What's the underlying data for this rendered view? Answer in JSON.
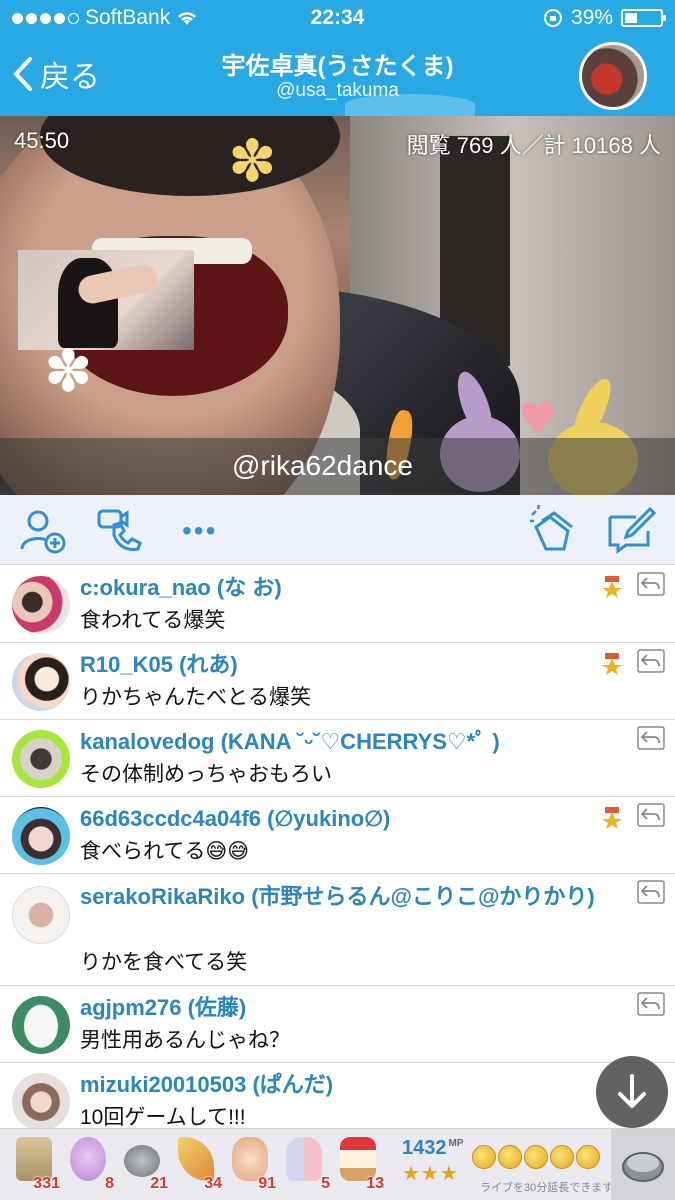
{
  "statusbar": {
    "carrier": "SoftBank",
    "time": "22:34",
    "battery": "39%"
  },
  "header": {
    "back_label": "戻る",
    "title": "宇佐卓真(うさたくま)",
    "handle": "@usa_takuma"
  },
  "video": {
    "elapsed": "45:50",
    "viewers": "閲覧 769 人／計 10168 人",
    "caption": "@rika62dance"
  },
  "toolbar": {
    "icons": [
      "add-user-icon",
      "call-icon",
      "more-icon",
      "clap-icon",
      "compose-icon"
    ],
    "more_label": "•••"
  },
  "comments": [
    {
      "name": "c:okura_nao (な お)",
      "text": "食われてる爆笑",
      "badge": true
    },
    {
      "name": "R10_K05 (れあ)",
      "text": "りかちゃんたべとる爆笑",
      "badge": true
    },
    {
      "name": "kanalovedog (KANA ˘ᵕ˘♡CHERRYS♡*ﾟ )",
      "text": "その体制めっちゃおもろい",
      "badge": false
    },
    {
      "name": "66d63ccdc4a04f6 (∅yukino∅)",
      "text": "食べられてる😅😅",
      "badge": true
    },
    {
      "name": "serakoRikaRiko (市野せらるん@こりこ@かりかり)",
      "text": "りかを食べてる笑",
      "badge": false
    },
    {
      "name": "agjpm276 (佐藤)",
      "text": "男性用あるんじゃね？",
      "badge": false
    },
    {
      "name": "mizuki20010503 (ぱんだ)",
      "text": "10回ゲームして!!!",
      "badge": false
    }
  ],
  "bottombar": {
    "items": [
      {
        "icon": "tea-icon",
        "count": "331"
      },
      {
        "icon": "bear-icon",
        "count": "8"
      },
      {
        "icon": "coin-icon",
        "count": "21"
      },
      {
        "icon": "cracker-icon",
        "count": "34"
      },
      {
        "icon": "clap-icon",
        "count": "91"
      },
      {
        "icon": "bunny-icon",
        "count": "5"
      },
      {
        "icon": "cake-icon",
        "count": "13"
      }
    ],
    "mp_value": "1432",
    "mp_unit": "MP",
    "stars": "★★★",
    "extend_note": "ライブを30分延長できます。"
  },
  "colors": {
    "accent": "#29a9e3",
    "name_blue": "#2a86bf",
    "count_red": "#e0342b"
  }
}
